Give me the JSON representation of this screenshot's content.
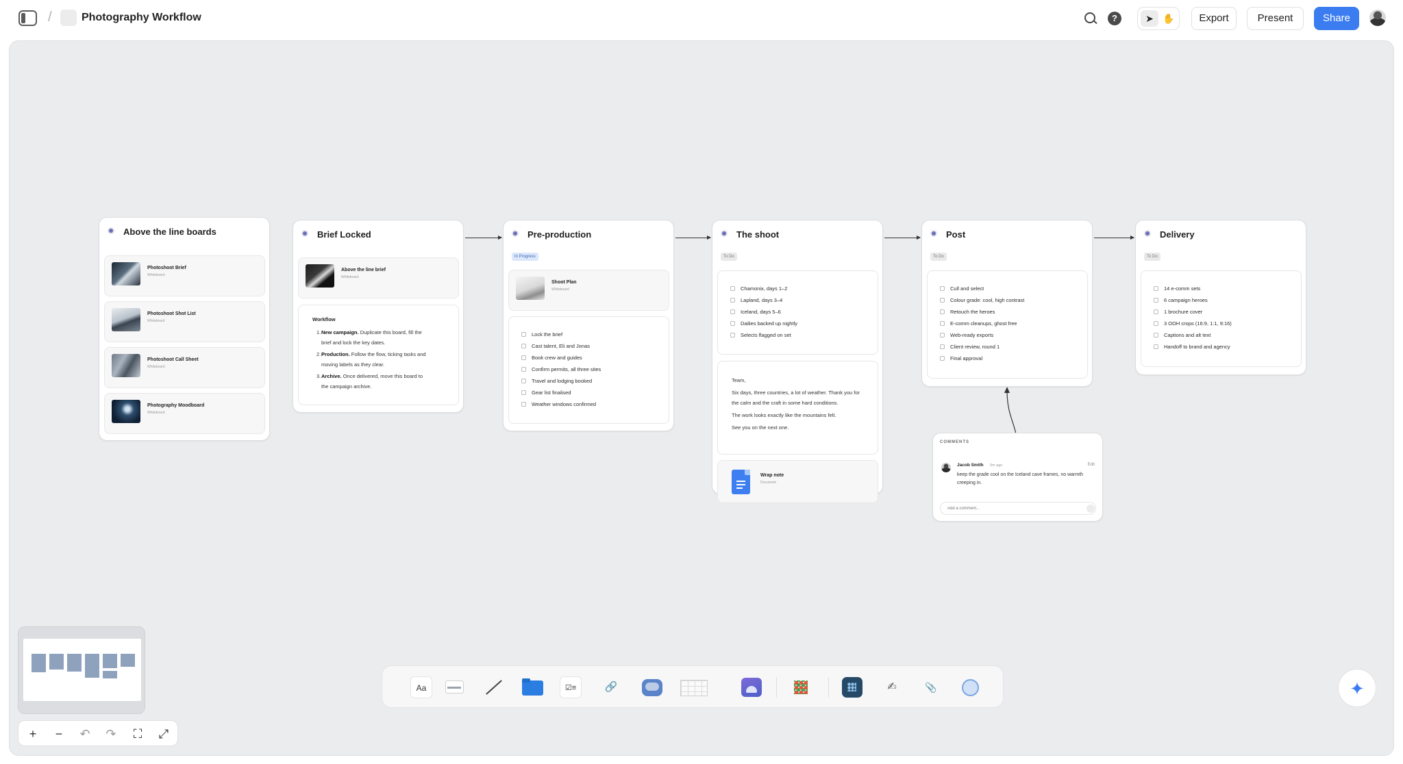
{
  "header": {
    "breadcrumb_separator": "/",
    "title": "Photography Workflow",
    "export_label": "Export",
    "present_label": "Present",
    "share_label": "Share",
    "help_glyph": "?"
  },
  "cards": {
    "above": {
      "title": "Above the line boards",
      "boards": [
        {
          "name": "Photoshoot Brief",
          "sub": "Whiteboard"
        },
        {
          "name": "Photoshoot Shot List",
          "sub": "Whiteboard"
        },
        {
          "name": "Photoshoot Call Sheet",
          "sub": "Whiteboard"
        },
        {
          "name": "Photography Moodboard",
          "sub": "Whiteboard"
        }
      ]
    },
    "brief": {
      "title": "Brief Locked",
      "board": {
        "name": "Above the line brief",
        "sub": "Whiteboard"
      },
      "workflow_heading": "Workflow",
      "steps": [
        {
          "num": "1.",
          "label": "New campaign.",
          "text": " Duplicate this board, fill the brief and lock the key dates."
        },
        {
          "num": "2.",
          "label": "Production.",
          "text": " Follow the flow, ticking tasks and moving labels as they clear."
        },
        {
          "num": "3.",
          "label": "Archive.",
          "text": " Once delivered, move this board to the campaign archive."
        }
      ]
    },
    "preprod": {
      "title": "Pre-production",
      "status": "In Progress",
      "board": {
        "name": "Shoot Plan",
        "sub": "Whiteboard"
      },
      "tasks": [
        "Lock the brief",
        "Cast talent, Eli and Jonas",
        "Book crew and guides",
        "Confirm permits, all three sites",
        "Travel and lodging booked",
        "Gear list finalised",
        "Weather windows confirmed"
      ]
    },
    "shoot": {
      "title": "The shoot",
      "status": "To Do",
      "tasks": [
        "Chamonix, days 1–2",
        "Lapland, days 3–4",
        "Iceland, days 5–6",
        "Dailies backed up nightly",
        "Selects flagged on set"
      ],
      "note": [
        "Team,",
        "Six days, three countries, a lot of weather. Thank you for the calm and the craft in some hard conditions.",
        "The work looks exactly like the mountains felt.",
        "See you on the next one."
      ],
      "doc": {
        "name": "Wrap note",
        "sub": "Document"
      }
    },
    "post": {
      "title": "Post",
      "status": "To Do",
      "tasks": [
        "Cull and select",
        "Colour grade: cool, high contrast",
        "Retouch the heroes",
        "E-comm cleanups, ghost free",
        "Web-ready exports",
        "Client review, round 1",
        "Final approval"
      ]
    },
    "delivery": {
      "title": "Delivery",
      "status": "To Do",
      "tasks": [
        "14 e-comm sets",
        "6 campaign heroes",
        "1 brochure cover",
        "3 OOH crops (16:9, 1:1, 9:16)",
        "Captions and alt text",
        "Handoff to brand and agency"
      ]
    }
  },
  "comments": {
    "label": "COMMENTS",
    "author": "Jacob Smith",
    "time": "5m ago",
    "edit_label": "Edit",
    "text": "keep the grade cool on the Iceland cave frames, no warmth creeping in.",
    "input_placeholder": "Add a comment..."
  },
  "zoom_controls": {
    "zoom_in": "+",
    "zoom_out": "−",
    "undo": "↶",
    "redo": "↷",
    "crop": "⛶",
    "fullscreen": "⤢"
  },
  "toolbar": {
    "text_tool": "Aa"
  },
  "colors": {
    "accent": "#3b7cf0",
    "canvas": "#ebecee",
    "minimap_block": "#8ea2bd"
  }
}
